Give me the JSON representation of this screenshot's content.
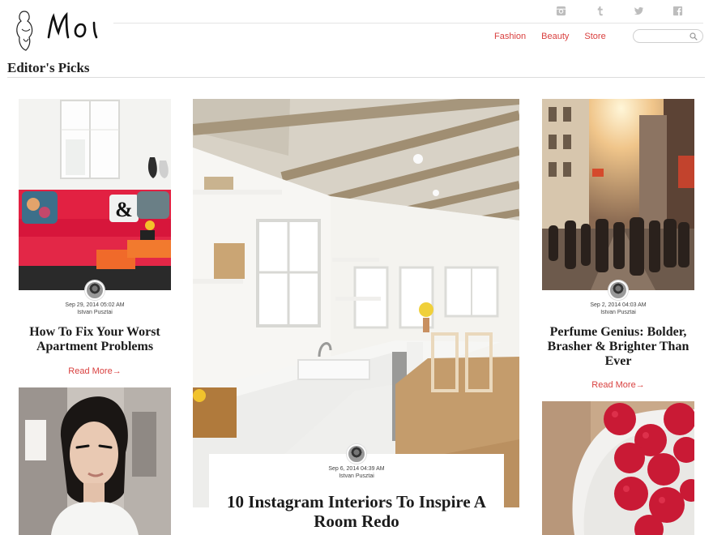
{
  "brand": {
    "logo_text": "Moi"
  },
  "social": [
    {
      "icon": "instagram-icon"
    },
    {
      "icon": "tumblr-icon"
    },
    {
      "icon": "twitter-icon"
    },
    {
      "icon": "facebook-icon"
    }
  ],
  "nav": {
    "items": [
      "Fashion",
      "Beauty",
      "Store"
    ]
  },
  "search": {
    "placeholder": "",
    "value": ""
  },
  "section": {
    "title": "Editor's Picks"
  },
  "colors": {
    "accent": "#d9403f",
    "text": "#222222",
    "divider": "#dcdcdc"
  },
  "articles": [
    {
      "date": "Sep 29, 2014 05:02 AM",
      "author": "Istvan Pusztai",
      "title": "How To Fix Your Worst Apartment Problems",
      "read_more": "Read More→"
    },
    {
      "date": "Sep 6, 2014 04:39 AM",
      "author": "Istvan Pusztai",
      "title": "10 Instagram Interiors To Inspire A Room Redo"
    },
    {
      "date": "Sep 2, 2014 04:03 AM",
      "author": "Istvan Pusztai",
      "title": "Perfume Genius: Bolder, Brasher & Brighter Than Ever",
      "read_more": "Read More→"
    }
  ]
}
